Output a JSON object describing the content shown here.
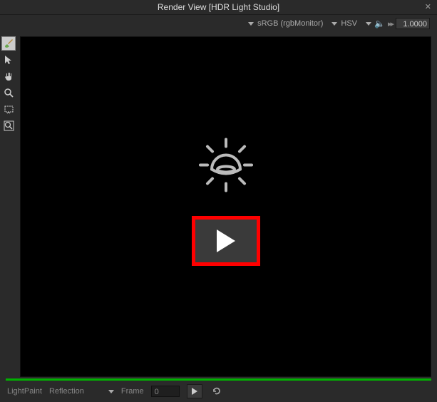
{
  "window": {
    "title": "Render View [HDR Light Studio]"
  },
  "topbar": {
    "colorspace": "sRGB (rgbMonitor)",
    "colormode": "HSV",
    "exposure": "1.0000"
  },
  "tools": {
    "active_index": 0,
    "items": [
      {
        "name": "lightpaint-tool",
        "glyph": "brush"
      },
      {
        "name": "pointer-tool",
        "glyph": "pointer"
      },
      {
        "name": "pan-tool",
        "glyph": "hand"
      },
      {
        "name": "zoom-tool",
        "glyph": "magnifier"
      },
      {
        "name": "region-tool",
        "glyph": "marquee"
      },
      {
        "name": "fit-tool",
        "glyph": "fit"
      }
    ]
  },
  "status": {
    "mode_label": "LightPaint",
    "mode_value": "Reflection",
    "frame_label": "Frame",
    "frame_value": "0"
  }
}
